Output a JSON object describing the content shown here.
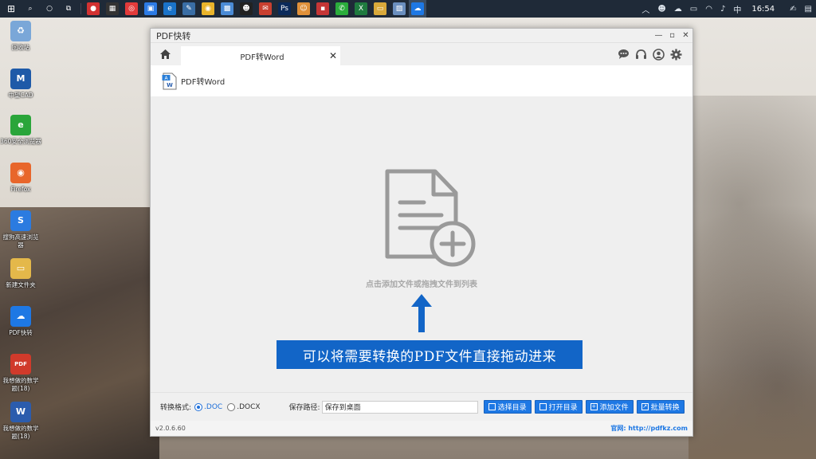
{
  "taskbar": {
    "tray": {
      "ime": "中",
      "time": "16:54"
    }
  },
  "desktop": {
    "items": [
      {
        "label": "回收站",
        "icon": "recycle-bin-icon",
        "color": "#7aa7d8",
        "glyph": "♻"
      },
      {
        "label": "中望CAD",
        "icon": "cad-app-icon",
        "color": "#1e5aa8",
        "glyph": "M"
      },
      {
        "label": "360安全浏览器",
        "icon": "browser-icon",
        "color": "#2aa53a",
        "glyph": "e"
      },
      {
        "label": "Firefox",
        "icon": "firefox-icon",
        "color": "#e8662b",
        "glyph": "◉"
      },
      {
        "label": "搜狗高速浏览器",
        "icon": "sogou-browser-icon",
        "color": "#2b7be0",
        "glyph": "S"
      },
      {
        "label": "新建文件夹",
        "icon": "folder-icon",
        "color": "#e4b84a",
        "glyph": "▭"
      },
      {
        "label": "PDF快转",
        "icon": "pdf-converter-icon",
        "color": "#1e78e4",
        "glyph": "☁"
      },
      {
        "label": "我想做的数学题(18)",
        "icon": "pdf-file-icon",
        "color": "#d03a2b",
        "glyph": "PDF"
      },
      {
        "label": "我想做的数学题(18)",
        "icon": "word-file-icon",
        "color": "#2b5cad",
        "glyph": "W"
      }
    ]
  },
  "window": {
    "title": "PDF快转",
    "tab_label": "PDF转Word",
    "tab_close": "✕",
    "subheader_title": "PDF转Word",
    "drop_hint": "点击添加文件或拖拽文件到列表",
    "caption": "可以将需要转换的PDF文件直接拖动进来",
    "bottom": {
      "format_label": "转换格式:",
      "format_options": [
        ".DOC",
        ".DOCX"
      ],
      "selected_format": ".DOC",
      "path_label": "保存路径:",
      "path_value": "保存到桌面",
      "buttons": {
        "choose_dir": "选择目录",
        "open_dir": "打开目录",
        "add_file": "添加文件",
        "batch_convert": "批量转换"
      }
    },
    "status": {
      "version": "v2.0.6.60",
      "site": "官网: http://pdfkz.com"
    }
  },
  "colors": {
    "accent": "#1e78e4",
    "caption_bg": "#1265c7"
  }
}
